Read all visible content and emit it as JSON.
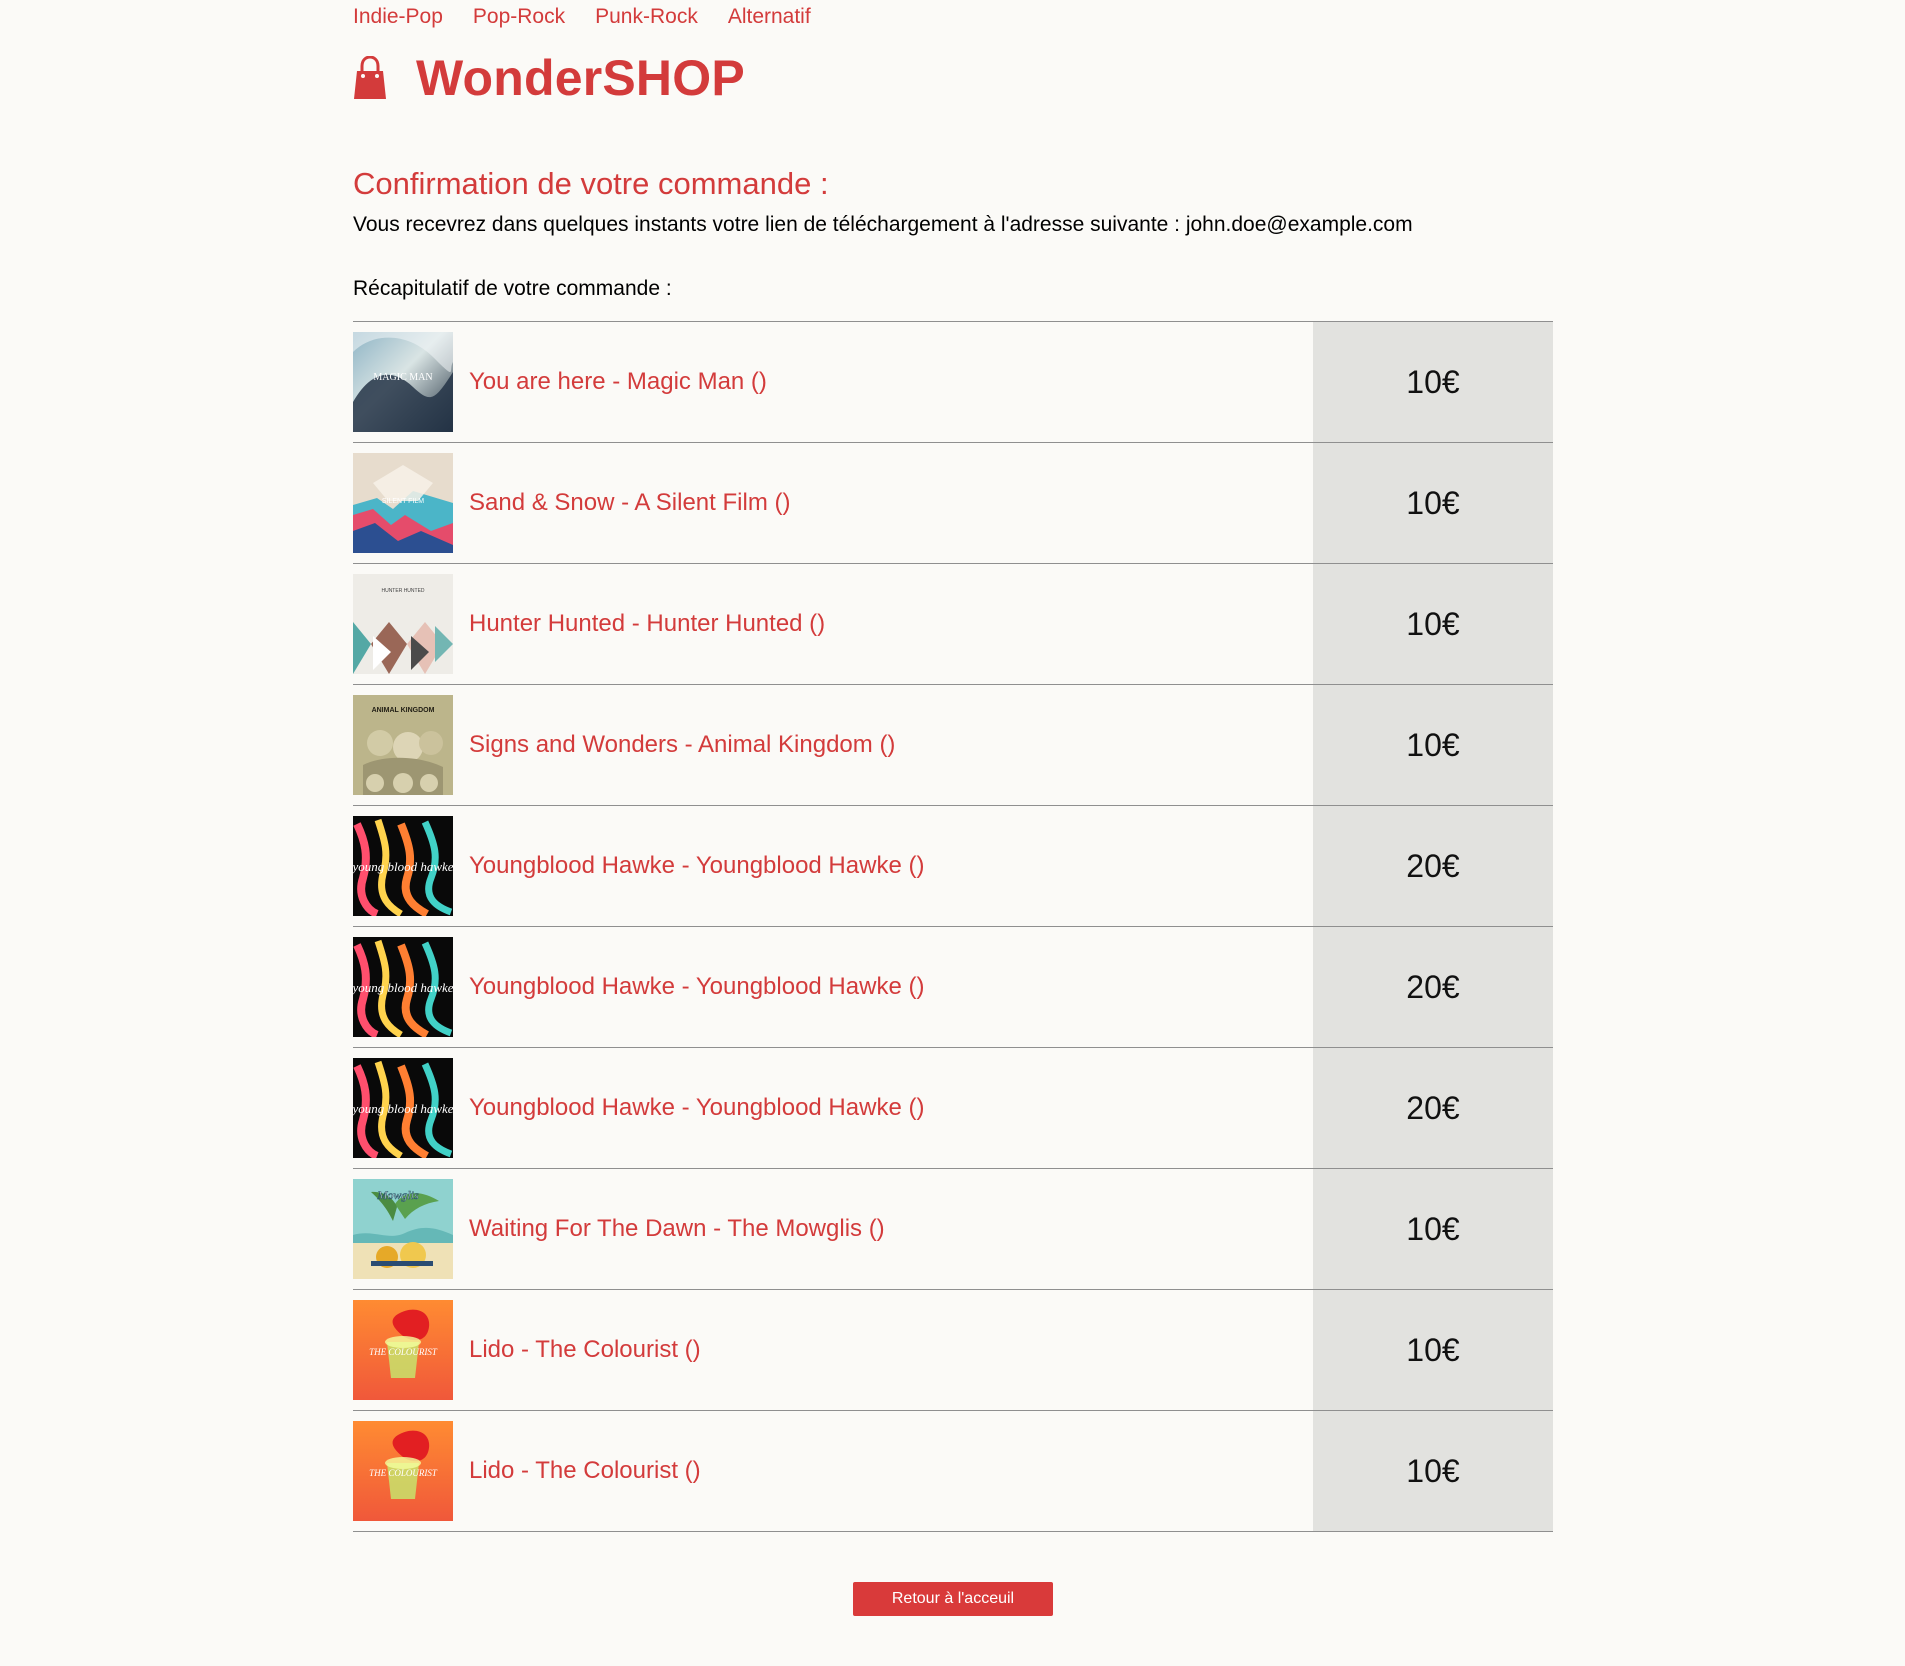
{
  "nav": {
    "items": [
      {
        "label": "Indie-Pop"
      },
      {
        "label": "Pop-Rock"
      },
      {
        "label": "Punk-Rock"
      },
      {
        "label": "Alternatif"
      }
    ]
  },
  "logo": {
    "icon": "shopping-bag-icon",
    "brand": "WonderSHOP",
    "color": "#d33b3b"
  },
  "confirmation": {
    "title": "Confirmation de votre commande :",
    "text": "Vous recevrez dans quelques instants votre lien de téléchargement à l'adresse suivante : john.doe@example.com",
    "summary_label": "Récapitulatif de votre commande :"
  },
  "orders": [
    {
      "title": "You are here - Magic Man ()",
      "price": "10€",
      "cover_text": "MAGIC MAN"
    },
    {
      "title": "Sand & Snow - A Silent Film ()",
      "price": "10€",
      "cover_text": "SILENT FILM"
    },
    {
      "title": "Hunter Hunted - Hunter Hunted ()",
      "price": "10€",
      "cover_text": "HUNTER HUNTED"
    },
    {
      "title": "Signs and Wonders - Animal Kingdom ()",
      "price": "10€",
      "cover_text": "ANIMAL KINGDOM"
    },
    {
      "title": "Youngblood Hawke - Youngblood Hawke ()",
      "price": "20€",
      "cover_text": "young blood hawke"
    },
    {
      "title": "Youngblood Hawke - Youngblood Hawke ()",
      "price": "20€",
      "cover_text": "young blood hawke"
    },
    {
      "title": "Youngblood Hawke - Youngblood Hawke ()",
      "price": "20€",
      "cover_text": "young blood hawke"
    },
    {
      "title": "Waiting For The Dawn - The Mowglis ()",
      "price": "10€",
      "cover_text": "Mowglis"
    },
    {
      "title": "Lido - The Colourist ()",
      "price": "10€",
      "cover_text": "THE COLOURIST"
    },
    {
      "title": "Lido - The Colourist ()",
      "price": "10€",
      "cover_text": "THE COLOURIST"
    }
  ],
  "actions": {
    "home_button": "Retour à l'acceuil"
  },
  "colors": {
    "accent": "#d33b3b",
    "price_cell": "#e2e2df",
    "background": "#fbfaf7"
  }
}
